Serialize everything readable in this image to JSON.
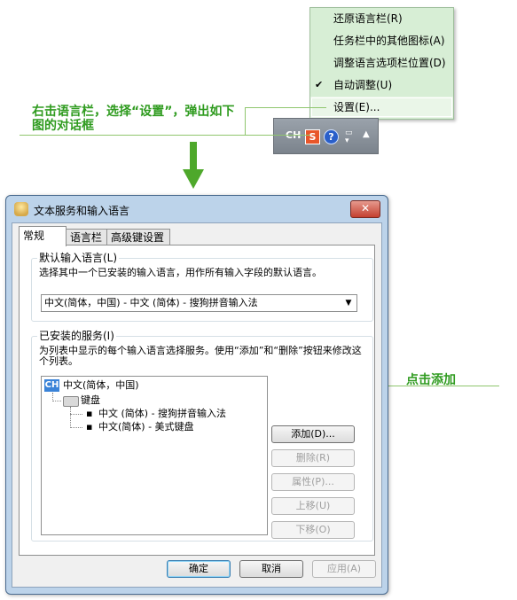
{
  "context_menu": {
    "items": [
      {
        "label": "还原语言栏(R)",
        "checked": false,
        "highlighted": false
      },
      {
        "label": "任务栏中的其他图标(A)",
        "checked": false,
        "highlighted": false
      },
      {
        "label": "调整语言选项栏位置(D)",
        "checked": false,
        "highlighted": false
      },
      {
        "label": "自动调整(U)",
        "checked": true,
        "highlighted": false
      },
      {
        "label": "设置(E)...",
        "checked": false,
        "highlighted": true
      }
    ],
    "check_glyph": "✔"
  },
  "taskbar": {
    "lang_label": "CH",
    "sogou_glyph": "S",
    "help_glyph": "?"
  },
  "annotations": {
    "step1": "右击语言栏，选择“设置”，弹出如下图的对话框",
    "step2": "点击添加",
    "color": "#2f9b1f"
  },
  "dialog": {
    "title": "文本服务和输入语言",
    "close_glyph": "✕",
    "tabs": [
      {
        "label": "常规",
        "active": true
      },
      {
        "label": "语言栏",
        "active": false
      },
      {
        "label": "高级键设置",
        "active": false
      }
    ],
    "default_group": {
      "title": "默认输入语言(L)",
      "description": "选择其中一个已安装的输入语言，用作所有输入字段的默认语言。",
      "selected_value": "中文(简体，中国) - 中文 (简体) - 搜狗拼音输入法"
    },
    "services_group": {
      "title": "已安装的服务(I)",
      "description": "为列表中显示的每个输入语言选择服务。使用“添加”和“删除”按钮来修改这个列表。",
      "tree": {
        "lang_badge": "CH",
        "language": "中文(简体，中国)",
        "category": "键盘",
        "items": [
          "中文 (简体) - 搜狗拼音输入法",
          "中文(简体) - 美式键盘"
        ],
        "bullet": "▪"
      },
      "buttons": {
        "add": "添加(D)...",
        "remove": "删除(R)",
        "properties": "属性(P)...",
        "move_up": "上移(U)",
        "move_down": "下移(O)"
      }
    },
    "footer": {
      "ok": "确定",
      "cancel": "取消",
      "apply": "应用(A)"
    }
  }
}
